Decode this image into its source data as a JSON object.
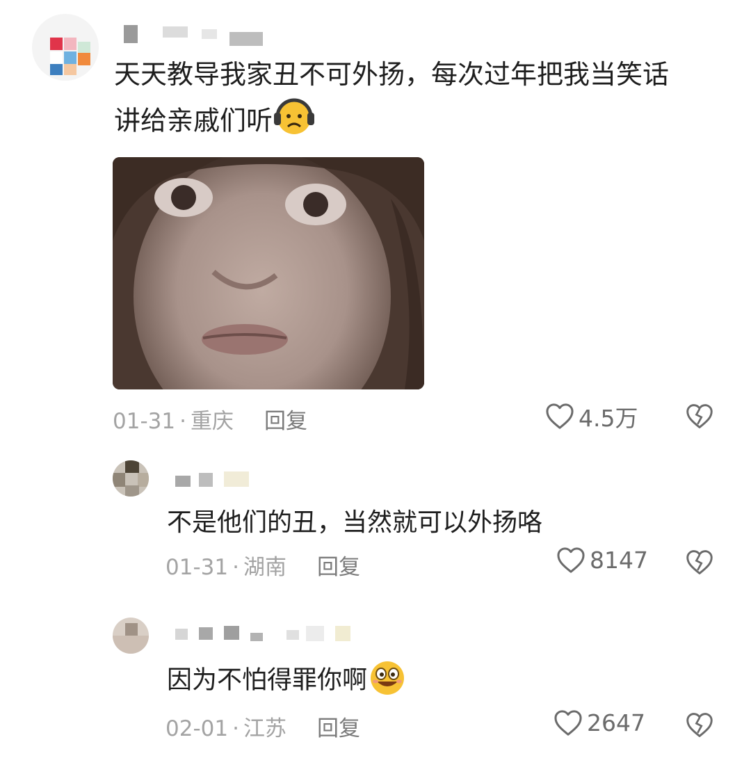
{
  "comments": [
    {
      "text_line1": "天天教导我家丑不可外扬，每次过年把我当笑话",
      "text_line2": "讲给亲戚们听",
      "emoji_icon": "headphone-frown-emoji",
      "date": "01-31",
      "location": "重庆",
      "reply_label": "回复",
      "likes": "4.5万"
    },
    {
      "text": "不是他们的丑，当然就可以外扬咯",
      "date": "01-31",
      "location": "湖南",
      "reply_label": "回复",
      "likes": "8147"
    },
    {
      "text": "因为不怕得罪你啊",
      "emoji_icon": "grinning-emoji",
      "date": "02-01",
      "location": "江苏",
      "reply_label": "回复",
      "likes": "2647"
    }
  ],
  "separator": "·",
  "colors": {
    "text": "#1e1e1e",
    "meta": "#a3a3a3",
    "icon": "#6b6b6b"
  }
}
